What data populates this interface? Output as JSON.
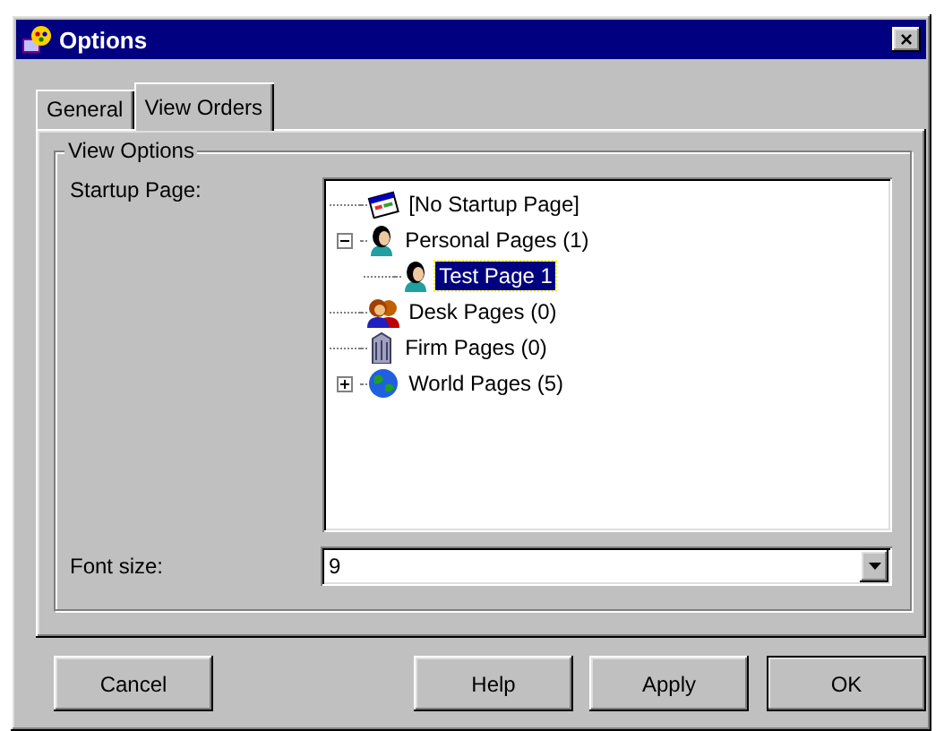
{
  "window": {
    "title": "Options",
    "close": "×"
  },
  "tabs": [
    {
      "label": "General",
      "selected": false
    },
    {
      "label": "View Orders",
      "selected": true
    }
  ],
  "group": {
    "title": "View Options"
  },
  "startup_page": {
    "label": "Startup Page:",
    "tree": [
      {
        "label": "[No Startup Page]",
        "kind": "calendar",
        "selected": false
      },
      {
        "label": "Personal Pages (1)",
        "kind": "person",
        "selected": false,
        "expanded": true,
        "children": [
          {
            "label": "Test Page 1",
            "kind": "person",
            "selected": true
          }
        ]
      },
      {
        "label": "Desk Pages (0)",
        "kind": "people",
        "selected": false
      },
      {
        "label": "Firm Pages (0)",
        "kind": "building",
        "selected": false
      },
      {
        "label": "World Pages (5)",
        "kind": "globe",
        "selected": false,
        "expanded": false
      }
    ]
  },
  "font_size": {
    "label": "Font size:",
    "value": "9"
  },
  "buttons": [
    {
      "label": "Cancel",
      "default": false
    },
    {
      "label": "Help",
      "default": false
    },
    {
      "label": "Apply",
      "default": false
    },
    {
      "label": "OK",
      "default": true
    }
  ]
}
